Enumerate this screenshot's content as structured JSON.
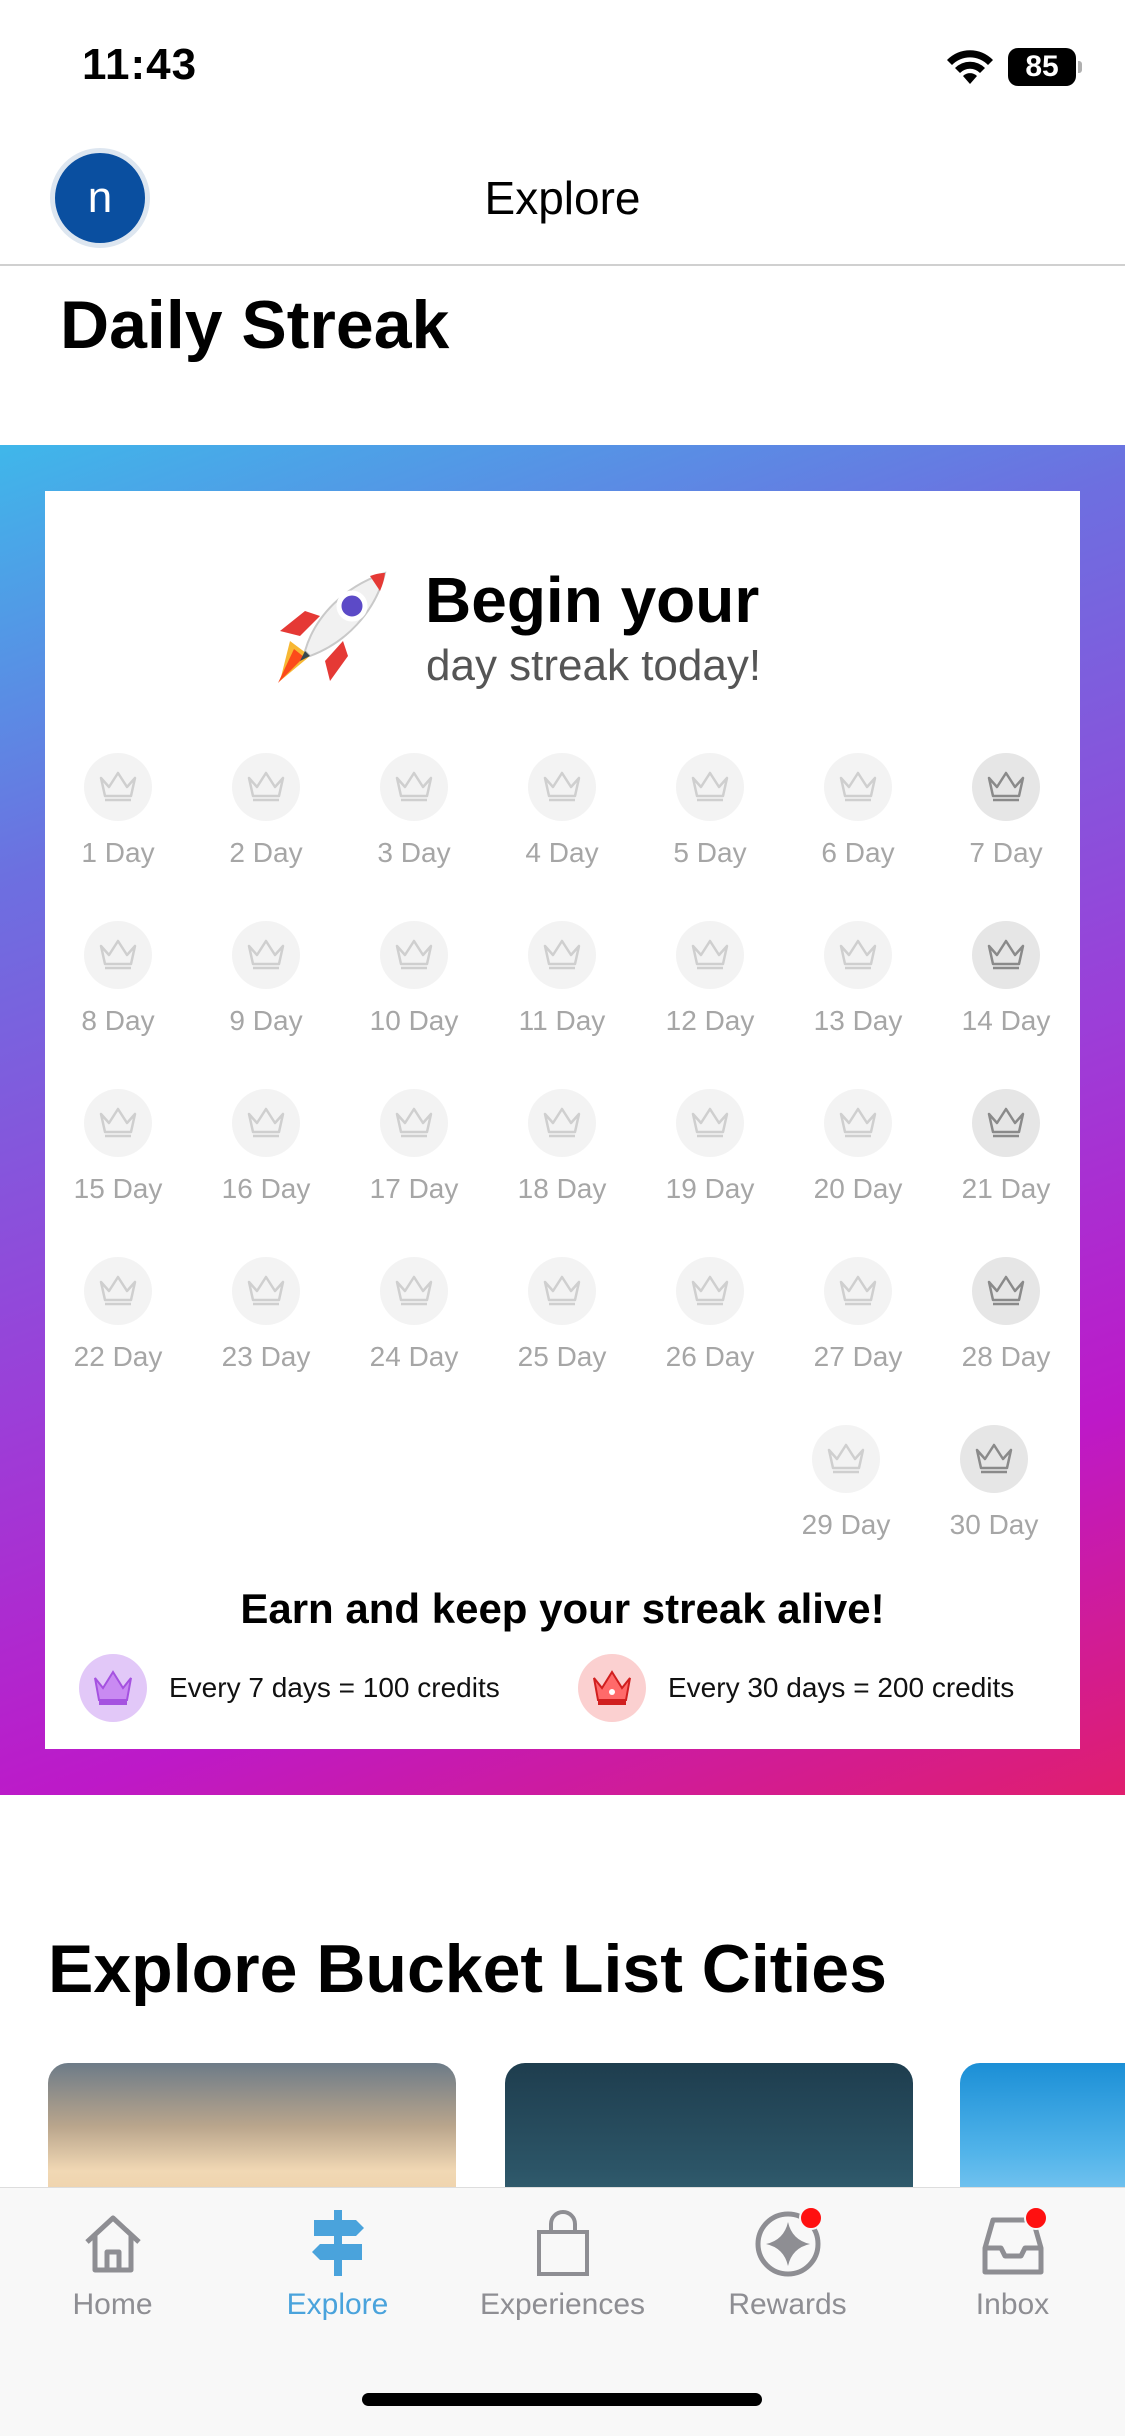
{
  "status_bar": {
    "time": "11:43",
    "battery": "85"
  },
  "header": {
    "avatar_initial": "n",
    "title": "Explore"
  },
  "daily_streak": {
    "title": "Daily Streak",
    "headline": "Begin your",
    "subheadline": "day streak today!",
    "days": [
      "1 Day",
      "2 Day",
      "3 Day",
      "4 Day",
      "5 Day",
      "6 Day",
      "7 Day",
      "8 Day",
      "9 Day",
      "10 Day",
      "11 Day",
      "12 Day",
      "13 Day",
      "14 Day",
      "15 Day",
      "16 Day",
      "17 Day",
      "18 Day",
      "19 Day",
      "20 Day",
      "21 Day",
      "22 Day",
      "23 Day",
      "24 Day",
      "25 Day",
      "26 Day",
      "27 Day",
      "28 Day",
      "29 Day",
      "30 Day"
    ],
    "footer_title": "Earn and keep your streak alive!",
    "rewards": [
      {
        "text": "Every 7 days = 100 credits",
        "icon": "crown-icon",
        "color": "#b266e6"
      },
      {
        "text": "Every 30 days = 200 credits",
        "icon": "crown-icon",
        "color": "#e0302f"
      }
    ]
  },
  "bucket_list": {
    "title": "Explore Bucket List Cities"
  },
  "tab_bar": {
    "active": "Explore",
    "accent_color": "#4aa3dc",
    "tabs": [
      {
        "label": "Home",
        "icon": "home-icon"
      },
      {
        "label": "Explore",
        "icon": "signpost-icon"
      },
      {
        "label": "Experiences",
        "icon": "bag-icon"
      },
      {
        "label": "Rewards",
        "icon": "sparkle-icon"
      },
      {
        "label": "Inbox",
        "icon": "inbox-icon"
      }
    ]
  }
}
